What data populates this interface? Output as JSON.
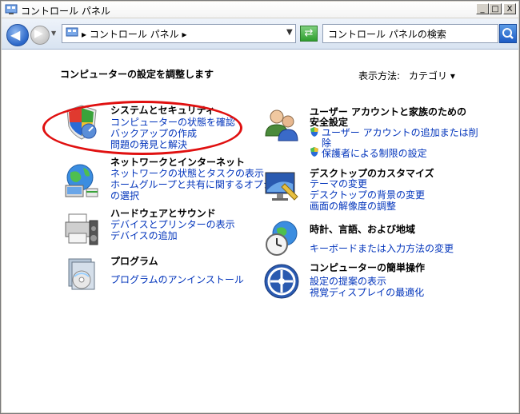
{
  "window": {
    "title": "コントロール パネル"
  },
  "caption_buttons": {
    "minimize": "_",
    "maximize": "□",
    "close": "X"
  },
  "nav": {
    "address": "▸ コントロール パネル ▸",
    "search_placeholder": "コントロール パネルの検索"
  },
  "content": {
    "heading": "コンピューターの設定を調整します",
    "view_by_label": "表示方法:",
    "view_by_value": "カテゴリ ▾"
  },
  "categories": {
    "system": {
      "title": "システムとセキュリティ",
      "links": [
        "コンピューターの状態を確認",
        "バックアップの作成",
        "問題の発見と解決"
      ]
    },
    "network": {
      "title": "ネットワークとインターネット",
      "links": [
        "ネットワークの状態とタスクの表示",
        "ホームグループと共有に関するオプション",
        "の選択"
      ]
    },
    "hardware": {
      "title": "ハードウェアとサウンド",
      "links": [
        "デバイスとプリンターの表示",
        "デバイスの追加"
      ]
    },
    "programs": {
      "title": "プログラム",
      "links": [
        "プログラムのアンインストール"
      ]
    },
    "user": {
      "title_line1": "ユーザー アカウントと家族のための",
      "title_line2": "安全設定",
      "links": [
        "ユーザー アカウントの追加または削",
        "除",
        "保護者による制限の設定"
      ]
    },
    "appearance": {
      "title": "デスクトップのカスタマイズ",
      "links": [
        "テーマの変更",
        "デスクトップの背景の変更",
        "画面の解像度の調整"
      ]
    },
    "clock": {
      "title": "時計、言語、および地域",
      "links": [
        "キーボードまたは入力方法の変更"
      ]
    },
    "ease": {
      "title": "コンピューターの簡単操作",
      "links": [
        "設定の提案の表示",
        "視覚ディスプレイの最適化"
      ]
    }
  }
}
